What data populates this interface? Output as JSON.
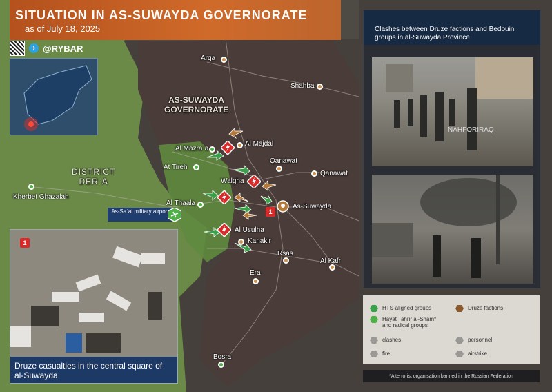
{
  "header": {
    "title": "SITUATION IN AS-SUWAYDA GOVERNORATE",
    "subtitle": "as of July 18, 2025"
  },
  "brand": {
    "handle": "@RYBAR",
    "qr_icon": "qr-code-icon",
    "telegram_icon": "telegram-icon"
  },
  "map": {
    "region_labels": {
      "governorate": [
        "AS-SUWAYDA",
        "GOVERNORATE"
      ],
      "district": [
        "DISTRICT",
        "DERʿA"
      ]
    },
    "settlements": {
      "arqa": "Arqa",
      "shahba": "Shahba",
      "al_majdal": "Al Majdal",
      "al_mazraa": "Al Mazraʿa",
      "at_tireh": "At Tireh",
      "qanawat_1": "Qanawat",
      "qanawat_2": "Qanawat",
      "walgha": "Walgha",
      "khirbet": "Kherbet Ghazalah",
      "al_thaala": "Al Thaala",
      "as_suwayda": "As-Suwayda",
      "al_usulha": "Al Usulha",
      "kanakir": "Kanakir",
      "rsas": "Rsas",
      "al_kafr": "Al Kafr",
      "era": "Era",
      "bosra": "Bosra"
    },
    "airport": "As-Saʿal military airport",
    "marker_number": "1",
    "colors": {
      "druze_area": "#4a3f3a",
      "government_area": "#6f8d4a",
      "hts_arrow": "#3aa14a",
      "druze_arrow": "#b57a3a",
      "clash_red": "#d92a2a"
    }
  },
  "right_panel": {
    "heading": "Clashes between Druze factions and Bedouin groups in al-Suwayda Province",
    "photo1_watermark": "NAHFORIRAQ"
  },
  "legend": {
    "hts": "HTS-aligned groups",
    "hayat": "Hayat Tahrir al-Sham* and radical groups",
    "druze": "Druze factions",
    "clashes": "clashes",
    "personnel": "personnel",
    "fire": "fire",
    "airstrike": "airstrike"
  },
  "disclaimer": "*A terrorist organisation banned in the Russian Federation",
  "inset": {
    "badge": "1",
    "caption": "Druze casualties in the central square of al-Suwayda"
  }
}
